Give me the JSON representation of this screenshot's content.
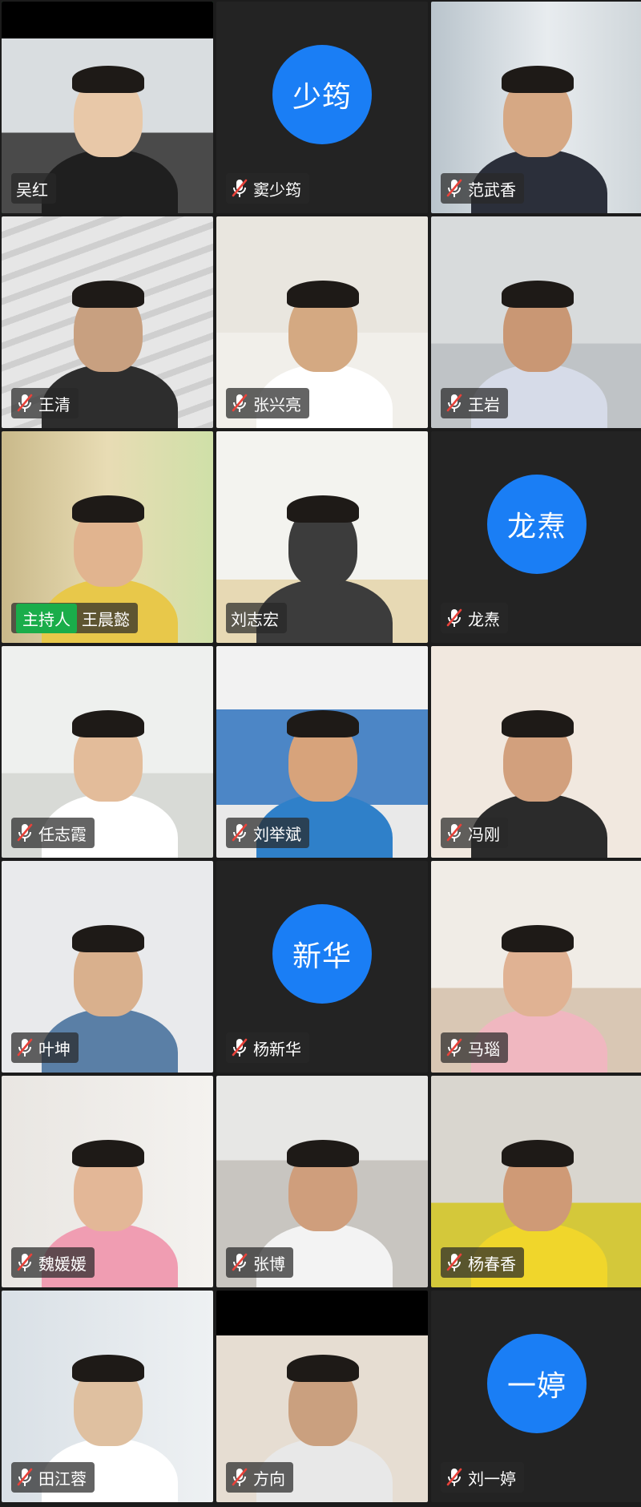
{
  "colors": {
    "avatar_blue": "#1a7ef5",
    "active_border": "#22b14c",
    "host_badge": "#1aad4a",
    "muted_mic_red": "#e8423a"
  },
  "host_badge_label": "主持人",
  "participants": [
    {
      "name": "吴红",
      "muted": false,
      "video": true,
      "active": true
    },
    {
      "name": "窦少筠",
      "muted": true,
      "video": false,
      "avatar_text": "少筠"
    },
    {
      "name": "范武香",
      "muted": true,
      "video": true
    },
    {
      "name": "王清",
      "muted": true,
      "video": true
    },
    {
      "name": "张兴亮",
      "muted": true,
      "video": true
    },
    {
      "name": "王岩",
      "muted": true,
      "video": true
    },
    {
      "name": "王晨懿",
      "muted": false,
      "video": true,
      "host": true
    },
    {
      "name": "刘志宏",
      "muted": false,
      "video": true
    },
    {
      "name": "龙焘",
      "muted": true,
      "video": false,
      "avatar_text": "龙焘"
    },
    {
      "name": "任志霞",
      "muted": true,
      "video": true
    },
    {
      "name": "刘举斌",
      "muted": true,
      "video": true
    },
    {
      "name": "冯刚",
      "muted": true,
      "video": true
    },
    {
      "name": "叶坤",
      "muted": true,
      "video": true
    },
    {
      "name": "杨新华",
      "muted": true,
      "video": false,
      "avatar_text": "新华"
    },
    {
      "name": "马瑙",
      "muted": true,
      "video": true
    },
    {
      "name": "魏媛媛",
      "muted": true,
      "video": true
    },
    {
      "name": "张博",
      "muted": true,
      "video": true
    },
    {
      "name": "杨春香",
      "muted": true,
      "video": true
    },
    {
      "name": "田江蓉",
      "muted": true,
      "video": true
    },
    {
      "name": "方向",
      "muted": true,
      "video": true
    },
    {
      "name": "刘一婷",
      "muted": true,
      "video": false,
      "avatar_text": "一婷"
    }
  ]
}
